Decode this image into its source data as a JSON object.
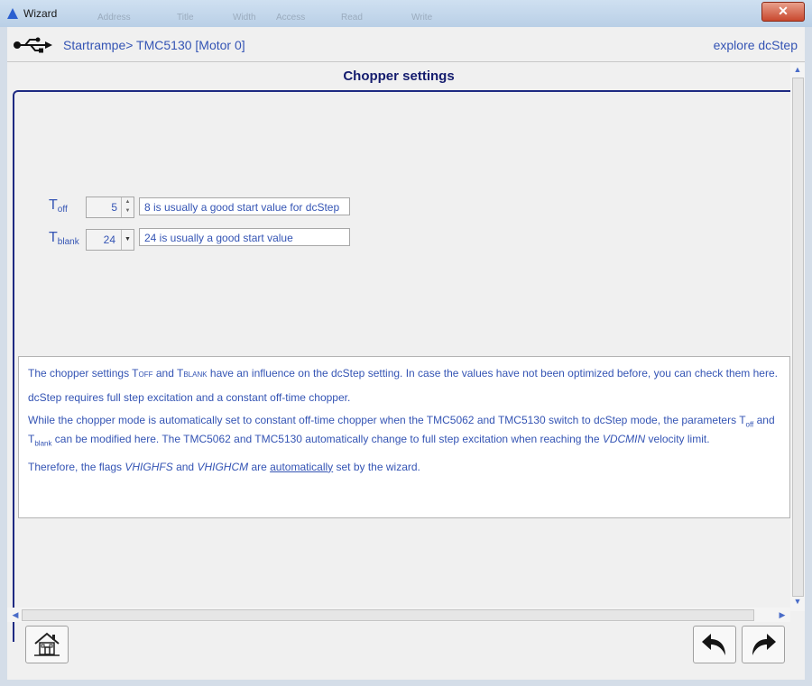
{
  "window": {
    "title": "Wizard",
    "ghost_labels": [
      "Address",
      "Title",
      "Width",
      "Access",
      "Read",
      "Write"
    ],
    "close_glyph": "✕"
  },
  "header": {
    "breadcrumb": "Startrampe> TMC5130 [Motor 0]",
    "explore_link": "explore dcStep"
  },
  "page": {
    "title": "Chopper settings"
  },
  "fields": {
    "toff": {
      "label_main": "T",
      "label_sub": "off",
      "value": "5",
      "hint": "8 is usually a good start value for dcStep"
    },
    "tblank": {
      "label_main": "T",
      "label_sub": "blank",
      "value": "24",
      "hint": "24 is usually a good start value"
    }
  },
  "info": {
    "p1_a": "The chopper settings T",
    "p1_sub1": "OFF",
    "p1_b": " and T",
    "p1_sub2": "BLANK",
    "p1_c": " have an influence on the dcStep setting. In case the values have not been optimized before, you can check them here.",
    "p2": "dcStep requires full step excitation and a constant off-time chopper.",
    "p3_a": "While the chopper mode is automatically set to constant off-time chopper when the TMC5062 and TMC5130 switch to dcStep mode, the parameters T",
    "p3_sub1": "off",
    "p3_b": " and T",
    "p3_sub2": "blank",
    "p3_c": " can be modified here. The TMC5062 and TMC5130 automatically change to full step excitation when reaching the ",
    "p3_em": "VDCMIN",
    "p3_d": " velocity limit.",
    "p4_a": "Therefore, the flags ",
    "p4_em1": "VHIGHFS",
    "p4_b": " and ",
    "p4_em2": "VHIGHCM",
    "p4_c": " are ",
    "p4_u": "automatically",
    "p4_d": " set by the wizard."
  },
  "icons": {
    "home": "home-icon",
    "back": "undo-arrow-icon",
    "forward": "redo-arrow-icon",
    "usb": "usb-icon"
  },
  "colors": {
    "text_blue": "#3454b4",
    "title_navy": "#141c6e",
    "frame_navy": "#1e2a82"
  }
}
